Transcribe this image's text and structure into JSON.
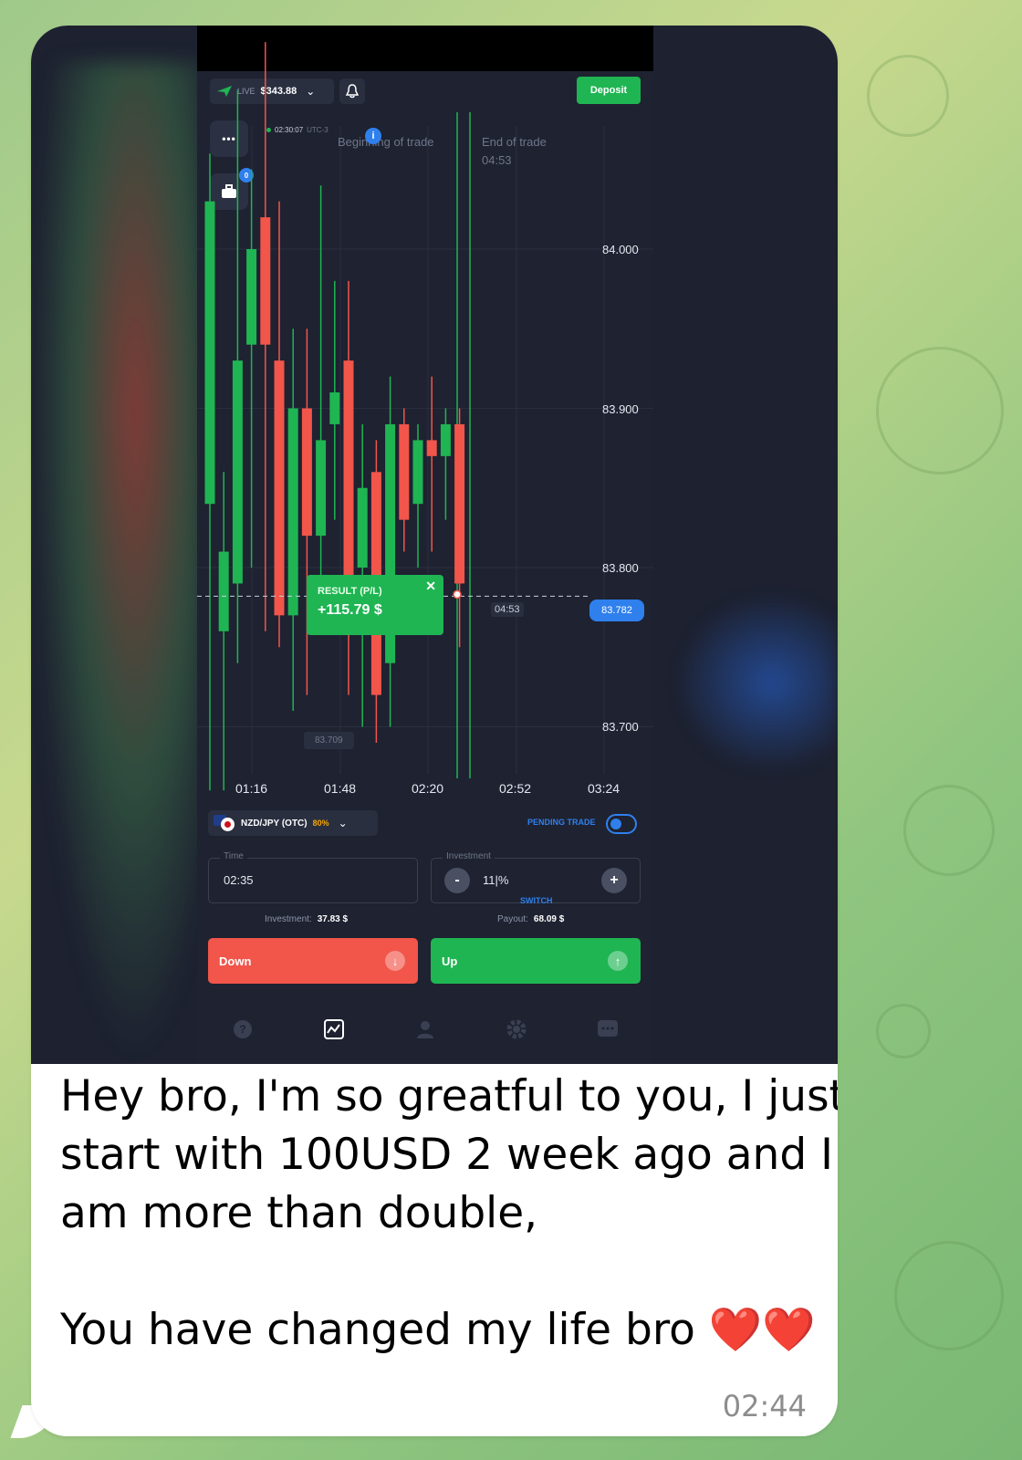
{
  "chat": {
    "message_lines": [
      "Hey bro, I'm so greatful to you, I just",
      "start with 100USD 2 week ago and I",
      "am more than double,",
      "",
      "You have changed my life bro ❤️❤️"
    ],
    "timestamp": "02:44"
  },
  "trading_app": {
    "header": {
      "account_mode": "LIVE",
      "balance": "$343.88",
      "deposit_label": "Deposit"
    },
    "side_buttons": {
      "menu_glyph": "•••",
      "trades_badge": "0"
    },
    "clock": {
      "time": "02:30:07",
      "timezone": "UTC-3"
    },
    "annotations": {
      "begin_label": "Beginning of trade",
      "end_label": "End of trade",
      "end_time": "04:53"
    },
    "result_popup": {
      "title": "RESULT (P/L)",
      "value": "+115.79 $",
      "close_glyph": "✕"
    },
    "current_price_tag": "83.782",
    "timer_tag": "04:53",
    "low_marker": "83.709",
    "price_axis": [
      "84.000",
      "83.900",
      "83.800",
      "83.700"
    ],
    "time_axis": [
      "01:16",
      "01:48",
      "02:20",
      "02:52",
      "03:24"
    ],
    "asset": {
      "pair": "NZD/JPY (OTC)",
      "payout_pct": "80%"
    },
    "pending_trade_label": "PENDING TRADE",
    "time_field": {
      "label": "Time",
      "value": "02:35"
    },
    "investment_field": {
      "label": "Investment",
      "value": "11|%",
      "minus": "-",
      "plus": "+",
      "switch_label": "SWITCH"
    },
    "investment_info": {
      "label": "Investment:",
      "value": "37.83 $"
    },
    "payout_info": {
      "label": "Payout:",
      "value": "68.09 $"
    },
    "down_button": "Down",
    "up_button": "Up",
    "nav_icons": [
      "help-icon",
      "chart-icon",
      "profile-icon",
      "settings-icon",
      "chat-icon"
    ]
  },
  "colors": {
    "up_green": "#1fb553",
    "down_red": "#f2554a",
    "accent_blue": "#2f80ed",
    "payout_orange": "#f7a600",
    "chart_bg": "#1e2231"
  },
  "chart_data": {
    "type": "candlestick",
    "instrument": "NZD/JPY (OTC)",
    "y_ticks": [
      84.0,
      83.9,
      83.8,
      83.7
    ],
    "x_ticks": [
      "01:16",
      "01:48",
      "02:20",
      "02:52",
      "03:24"
    ],
    "current_price": 83.782,
    "candles": [
      {
        "o": 83.84,
        "c": 84.03,
        "h": 84.06,
        "l": 83.66,
        "dir": "up"
      },
      {
        "o": 83.76,
        "c": 83.81,
        "h": 83.86,
        "l": 83.66,
        "dir": "up"
      },
      {
        "o": 83.79,
        "c": 83.93,
        "h": 84.1,
        "l": 83.74,
        "dir": "up"
      },
      {
        "o": 83.94,
        "c": 84.0,
        "h": 84.05,
        "l": 83.8,
        "dir": "up"
      },
      {
        "o": 84.02,
        "c": 83.94,
        "h": 84.13,
        "l": 83.76,
        "dir": "down"
      },
      {
        "o": 83.93,
        "c": 83.77,
        "h": 84.03,
        "l": 83.75,
        "dir": "down"
      },
      {
        "o": 83.77,
        "c": 83.9,
        "h": 83.95,
        "l": 83.71,
        "dir": "up"
      },
      {
        "o": 83.9,
        "c": 83.82,
        "h": 83.95,
        "l": 83.72,
        "dir": "down"
      },
      {
        "o": 83.82,
        "c": 83.88,
        "h": 84.04,
        "l": 83.79,
        "dir": "up"
      },
      {
        "o": 83.89,
        "c": 83.91,
        "h": 83.98,
        "l": 83.83,
        "dir": "up"
      },
      {
        "o": 83.93,
        "c": 83.76,
        "h": 83.98,
        "l": 83.72,
        "dir": "down"
      },
      {
        "o": 83.8,
        "c": 83.85,
        "h": 83.89,
        "l": 83.7,
        "dir": "up"
      },
      {
        "o": 83.86,
        "c": 83.72,
        "h": 83.88,
        "l": 83.69,
        "dir": "down"
      },
      {
        "o": 83.74,
        "c": 83.89,
        "h": 83.92,
        "l": 83.7,
        "dir": "up"
      },
      {
        "o": 83.89,
        "c": 83.83,
        "h": 83.9,
        "l": 83.81,
        "dir": "down"
      },
      {
        "o": 83.84,
        "c": 83.88,
        "h": 83.89,
        "l": 83.8,
        "dir": "up"
      },
      {
        "o": 83.88,
        "c": 83.87,
        "h": 83.92,
        "l": 83.81,
        "dir": "down"
      },
      {
        "o": 83.87,
        "c": 83.89,
        "h": 83.9,
        "l": 83.83,
        "dir": "up"
      },
      {
        "o": 83.89,
        "c": 83.79,
        "h": 83.9,
        "l": 83.75,
        "dir": "down"
      }
    ]
  }
}
